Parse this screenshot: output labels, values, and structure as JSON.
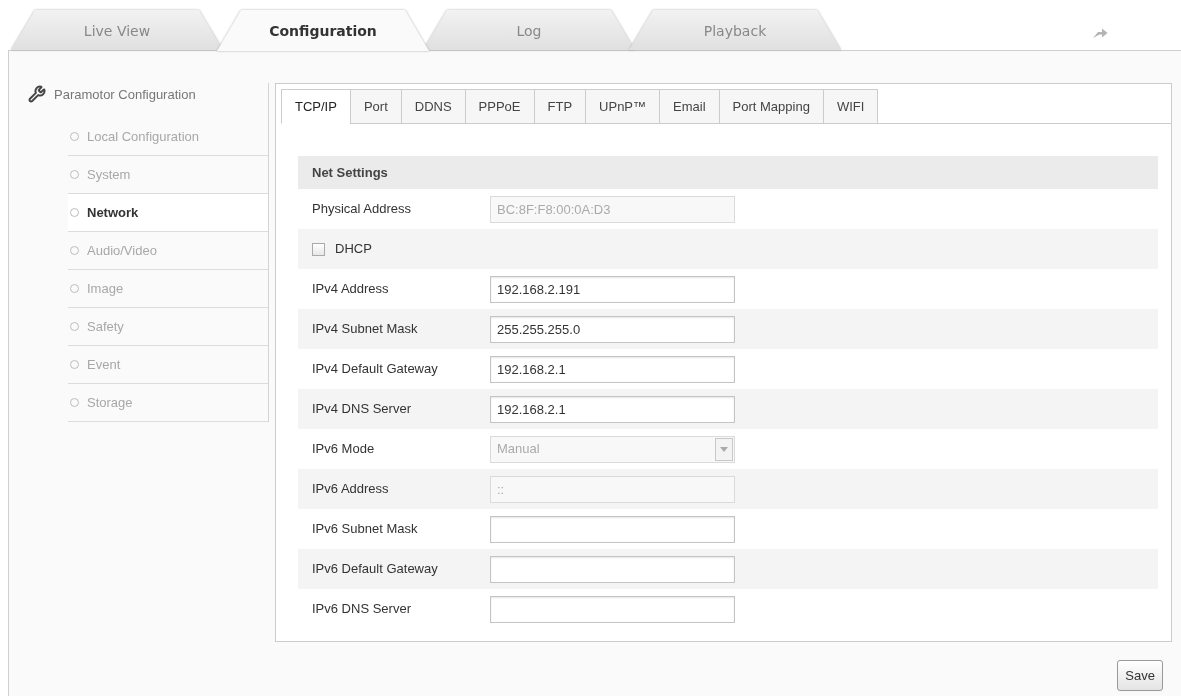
{
  "top_tabs": [
    {
      "label": "Live View",
      "selected": false
    },
    {
      "label": "Configuration",
      "selected": true
    },
    {
      "label": "Log",
      "selected": false
    },
    {
      "label": "Playback",
      "selected": false
    }
  ],
  "sidebar": {
    "title": "Paramotor Configuration",
    "items": [
      {
        "label": "Local Configuration",
        "selected": false
      },
      {
        "label": "System",
        "selected": false
      },
      {
        "label": "Network",
        "selected": true
      },
      {
        "label": "Audio/Video",
        "selected": false
      },
      {
        "label": "Image",
        "selected": false
      },
      {
        "label": "Safety",
        "selected": false
      },
      {
        "label": "Event",
        "selected": false
      },
      {
        "label": "Storage",
        "selected": false
      }
    ]
  },
  "sub_tabs": [
    {
      "label": "TCP/IP",
      "selected": true
    },
    {
      "label": "Port",
      "selected": false
    },
    {
      "label": "DDNS",
      "selected": false
    },
    {
      "label": "PPPoE",
      "selected": false
    },
    {
      "label": "FTP",
      "selected": false
    },
    {
      "label": "UPnP™",
      "selected": false
    },
    {
      "label": "Email",
      "selected": false
    },
    {
      "label": "Port Mapping",
      "selected": false
    },
    {
      "label": "WIFI",
      "selected": false
    }
  ],
  "net_settings": {
    "title": "Net Settings",
    "rows": [
      {
        "kind": "field",
        "label": "Physical Address",
        "value": "BC:8F:F8:00:0A:D3",
        "disabled": true
      },
      {
        "kind": "checkbox",
        "label": "DHCP",
        "checked": false
      },
      {
        "kind": "field",
        "label": "IPv4 Address",
        "value": "192.168.2.191",
        "disabled": false
      },
      {
        "kind": "field",
        "label": "IPv4 Subnet Mask",
        "value": "255.255.255.0",
        "disabled": false
      },
      {
        "kind": "field",
        "label": "IPv4 Default Gateway",
        "value": "192.168.2.1",
        "disabled": false
      },
      {
        "kind": "field",
        "label": "IPv4 DNS Server",
        "value": "192.168.2.1",
        "disabled": false
      },
      {
        "kind": "select",
        "label": "IPv6 Mode",
        "value": "Manual",
        "disabled": true
      },
      {
        "kind": "field",
        "label": "IPv6 Address",
        "value": "::",
        "disabled": true
      },
      {
        "kind": "field",
        "label": "IPv6 Subnet Mask",
        "disabled": false
      },
      {
        "kind": "field",
        "label": "IPv6 Default Gateway",
        "disabled": false
      },
      {
        "kind": "field",
        "label": "IPv6 DNS Server",
        "disabled": false
      }
    ]
  },
  "buttons": [
    "Save"
  ]
}
